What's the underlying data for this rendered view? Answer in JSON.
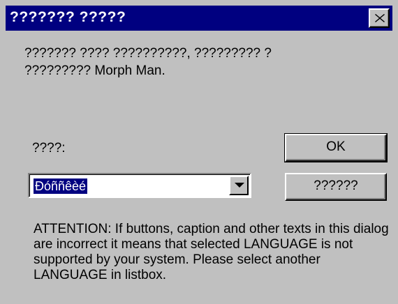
{
  "window": {
    "title": "??????? ?????",
    "close_icon": "close-icon"
  },
  "message": "??????? ???? ??????????, ????????? ?\n????????? Morph Man.",
  "language": {
    "label": "????:",
    "selected_value": "Ðóññêèé",
    "dropdown_icon": "chevron-down-icon"
  },
  "buttons": {
    "ok_label": "OK",
    "cancel_label": "??????"
  },
  "attention_text": "ATTENTION: If buttons, caption and other texts in this dialog are incorrect it means that selected LANGUAGE is not supported by your system. Please select another LANGUAGE in listbox.",
  "colors": {
    "titlebar": "#000080",
    "face": "#c0c0c0",
    "selection": "#000080"
  }
}
